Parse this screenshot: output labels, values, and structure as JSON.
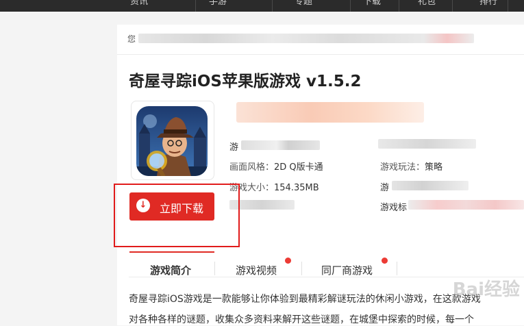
{
  "topnav": {
    "items": [
      "资讯",
      "手游",
      "专题",
      "下载",
      "礼包",
      "排行"
    ]
  },
  "breadcrumb": {
    "prefix": "您"
  },
  "game": {
    "title": "奇屋寻踪iOS苹果版游戏 v1.5.2",
    "info": {
      "style_label": "画面风格：",
      "style_value": "2D Q版卡通",
      "size_label": "游戏大小：",
      "size_value": "154.35MB",
      "gameplay_label": "游戏玩法：",
      "gameplay_value": "策略",
      "type_label_partial": "游",
      "version_label_partial": "游",
      "tag_label": "游戏标"
    }
  },
  "download_button": {
    "label": "立即下载"
  },
  "tabs": [
    {
      "label": "游戏简介"
    },
    {
      "label": "游戏视频"
    },
    {
      "label": "同厂商游戏"
    }
  ],
  "description": {
    "line1": "奇屋寻踪iOS游戏是一款能够让你体验到最精彩解谜玩法的休闲小游戏，在这款游戏",
    "line2": "对各种各样的谜题，收集众多资料来解开这些谜题，在城堡中探索的时候，每一个"
  },
  "watermark": "Bai经验",
  "colors": {
    "accent": "#e02a24",
    "highlight": "#e11b1b",
    "topbar": "#2b2b2b"
  }
}
